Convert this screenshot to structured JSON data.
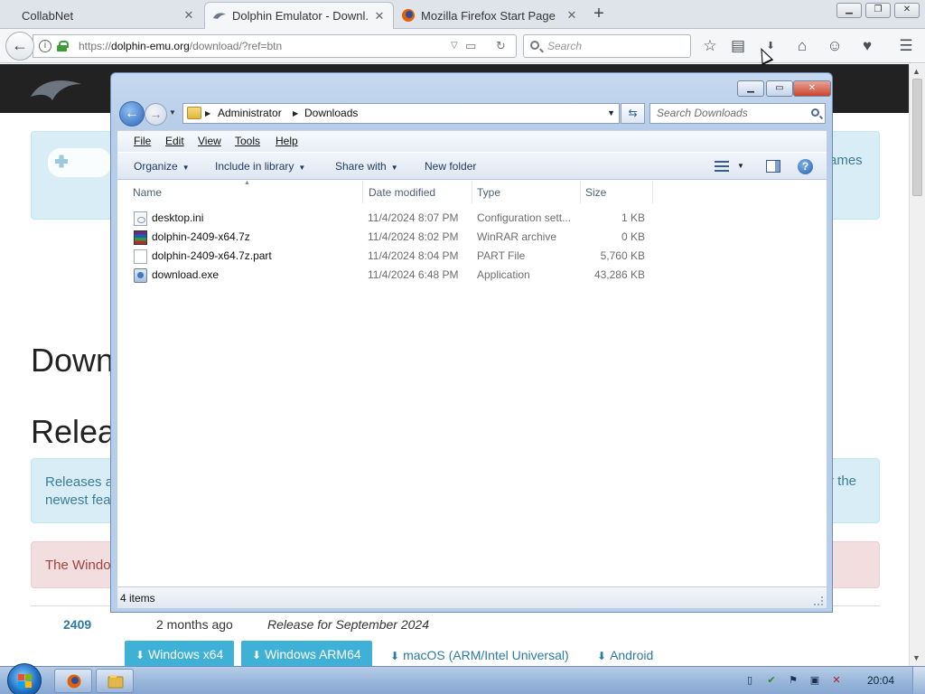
{
  "browser": {
    "tabs": [
      {
        "label": "CollabNet"
      },
      {
        "label": "Dolphin Emulator - Downl..."
      },
      {
        "label": "Mozilla Firefox Start Page"
      }
    ],
    "url_prefix": "https://",
    "url_domain": "dolphin-emu.org",
    "url_path": "/download/?ref=btn",
    "search_placeholder": "Search"
  },
  "webpage": {
    "games_partial": "ames",
    "heading_downloads": "Down",
    "heading_releases": "Relea",
    "releases_text_line1": "Releases a",
    "releases_text_line2": "newest feat",
    "releases_text_right": "r the",
    "warning_text": "The Window",
    "release": {
      "version": "2409",
      "age": "2 months ago",
      "note": "Release for September 2024"
    },
    "download_buttons": [
      {
        "label": "Windows x64"
      },
      {
        "label": "Windows ARM64"
      }
    ],
    "download_links": [
      {
        "label": "macOS (ARM/Intel Universal)"
      },
      {
        "label": "Android"
      }
    ]
  },
  "explorer": {
    "breadcrumb": [
      "Administrator",
      "Downloads"
    ],
    "search_placeholder": "Search Downloads",
    "menu": [
      "File",
      "Edit",
      "View",
      "Tools",
      "Help"
    ],
    "commands": {
      "organize": "Organize",
      "include": "Include in library",
      "share": "Share with",
      "new_folder": "New folder"
    },
    "columns": {
      "name": "Name",
      "date": "Date modified",
      "type": "Type",
      "size": "Size"
    },
    "files": [
      {
        "name": "desktop.ini",
        "date": "11/4/2024 8:07 PM",
        "type": "Configuration sett...",
        "size": "1 KB",
        "icon": "ini-file-icon"
      },
      {
        "name": "dolphin-2409-x64.7z",
        "date": "11/4/2024 8:02 PM",
        "type": "WinRAR archive",
        "size": "0 KB",
        "icon": "winrar-archive-icon"
      },
      {
        "name": "dolphin-2409-x64.7z.part",
        "date": "11/4/2024 8:04 PM",
        "type": "PART File",
        "size": "5,760 KB",
        "icon": "generic-file-icon"
      },
      {
        "name": "download.exe",
        "date": "11/4/2024 6:48 PM",
        "type": "Application",
        "size": "43,286 KB",
        "icon": "application-icon"
      }
    ],
    "status": "4 items"
  },
  "taskbar": {
    "clock": "20:04"
  }
}
